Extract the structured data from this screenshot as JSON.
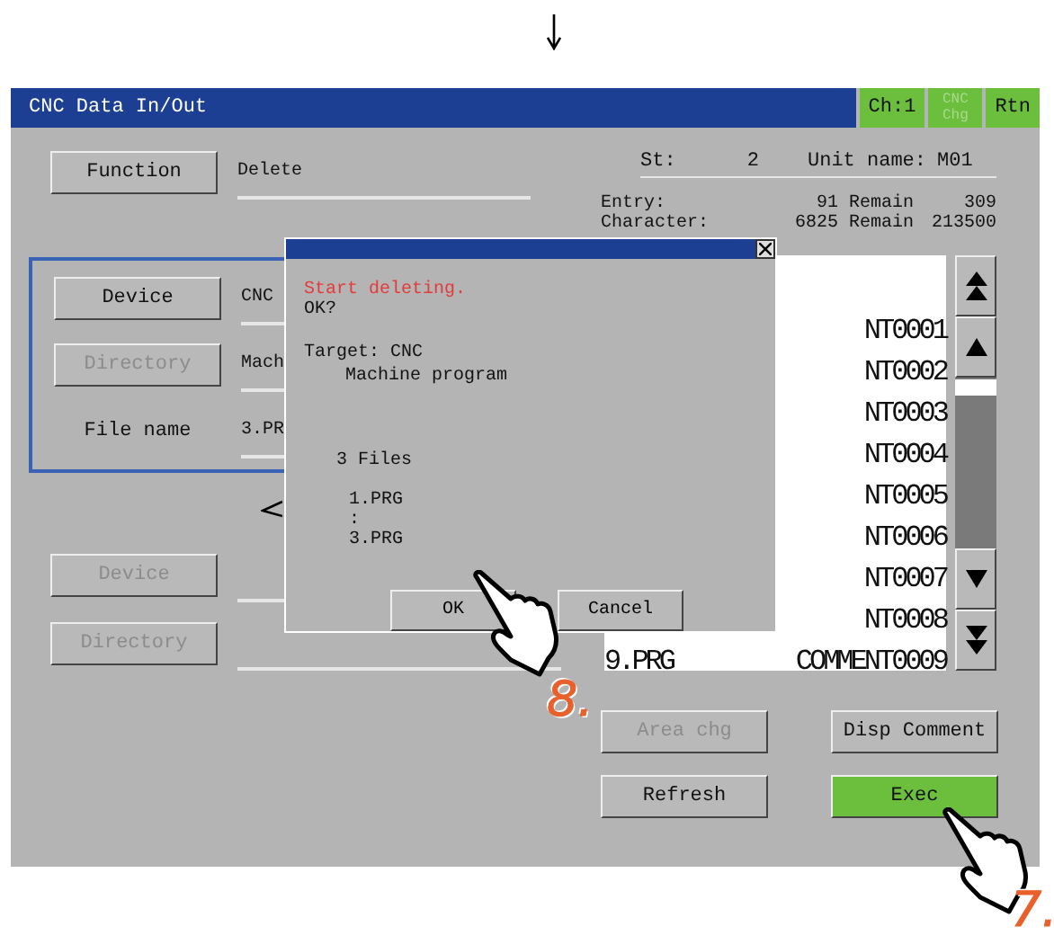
{
  "window": {
    "title": "CNC Data In/Out",
    "header_buttons": [
      {
        "label": "Ch:1",
        "disabled": false
      },
      {
        "label": "CNC Chg",
        "disabled": true
      },
      {
        "label": "Rtn",
        "disabled": false
      }
    ]
  },
  "function": {
    "button": "Function",
    "value": "Delete"
  },
  "status": {
    "st_label": "St:",
    "st_value": "2",
    "unit_label": "Unit name:",
    "unit_value": "M01"
  },
  "counts": [
    {
      "label": "Entry:",
      "value": "91",
      "remain_label": "Remain",
      "remain": "309"
    },
    {
      "label": "Character:",
      "value": "6825",
      "remain_label": "Remain",
      "remain": "213500"
    }
  ],
  "source": {
    "device": {
      "button": "Device",
      "disabled": false,
      "value": "CNC"
    },
    "directory": {
      "button": "Directory",
      "disabled": true,
      "value": "Mach"
    },
    "file_name": {
      "label": "File name",
      "value": "3.PR"
    }
  },
  "destination": {
    "device": {
      "button": "Device",
      "disabled": true
    },
    "directory": {
      "button": "Directory",
      "disabled": true
    }
  },
  "file_list": [
    {
      "comment": "NT0001"
    },
    {
      "comment": "NT0002"
    },
    {
      "comment": "NT0003"
    },
    {
      "comment": "NT0004"
    },
    {
      "comment": "NT0005"
    },
    {
      "comment": "NT0006"
    },
    {
      "comment": "NT0007"
    },
    {
      "comment": "NT0008"
    },
    {
      "name": "9.PRG",
      "comment": "COMMENT0009"
    }
  ],
  "bottom_buttons": [
    {
      "label": "Area chg",
      "disabled": true,
      "active": false
    },
    {
      "label": "Disp Comment",
      "disabled": false,
      "active": false
    },
    {
      "label": "Refresh",
      "disabled": false,
      "active": false
    },
    {
      "label": "Exec",
      "disabled": false,
      "active": true
    }
  ],
  "dialog": {
    "message": "Start deleting.",
    "prompt": "OK?",
    "target_label": "Target: CNC",
    "target_detail": "Machine program",
    "count": "3 Files",
    "files": [
      "1.PRG",
      ":",
      "3.PRG"
    ],
    "buttons": [
      "OK",
      "Cancel"
    ]
  },
  "callouts": [
    {
      "step": "8."
    },
    {
      "step": "7."
    }
  ]
}
